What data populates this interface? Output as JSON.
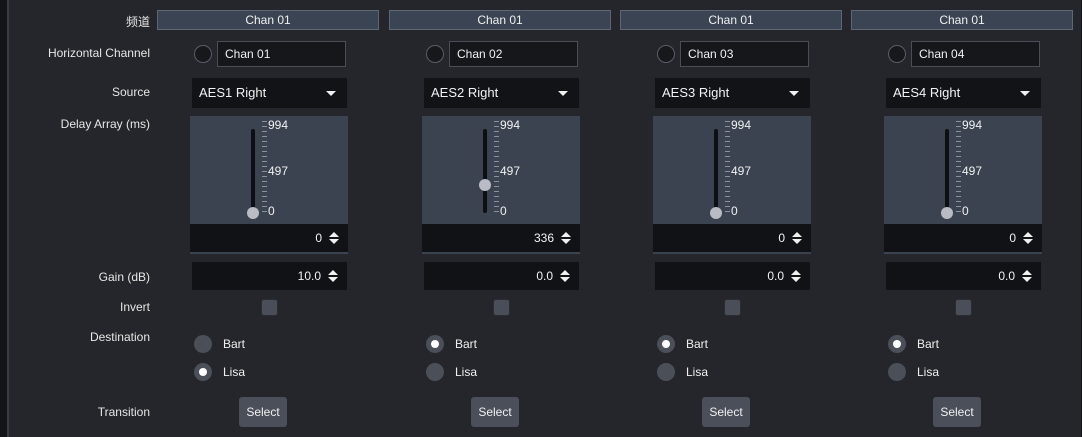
{
  "labels": {
    "header": "频道",
    "horizontal_channel": "Horizontal Channel",
    "source": "Source",
    "delay_array": "Delay Array (ms)",
    "gain": "Gain (dB)",
    "invert": "Invert",
    "destination": "Destination",
    "transition": "Transition"
  },
  "slider_scale": {
    "max": "994",
    "mid": "497",
    "min": "0"
  },
  "channels": [
    {
      "header": "Chan 01",
      "name": "Chan 01",
      "source": "AES1 Right",
      "delay": "0",
      "delay_level": 0,
      "gain": "10.0",
      "invert": false,
      "destination": "Lisa",
      "dest_options": [
        "Bart",
        "Lisa"
      ],
      "transition_button": "Select"
    },
    {
      "header": "Chan 01",
      "name": "Chan 02",
      "source": "AES2 Right",
      "delay": "336",
      "delay_level": 0.338,
      "gain": "0.0",
      "invert": false,
      "destination": "Bart",
      "dest_options": [
        "Bart",
        "Lisa"
      ],
      "transition_button": "Select"
    },
    {
      "header": "Chan 01",
      "name": "Chan 03",
      "source": "AES3 Right",
      "delay": "0",
      "delay_level": 0,
      "gain": "0.0",
      "invert": false,
      "destination": "Bart",
      "dest_options": [
        "Bart",
        "Lisa"
      ],
      "transition_button": "Select"
    },
    {
      "header": "Chan 01",
      "name": "Chan 04",
      "source": "AES4 Right",
      "delay": "0",
      "delay_level": 0,
      "gain": "0.0",
      "invert": false,
      "destination": "Bart",
      "dest_options": [
        "Bart",
        "Lisa"
      ],
      "transition_button": "Select"
    }
  ],
  "colors": {
    "panel": "#25262b",
    "header_bg": "#3a4452",
    "slider_bg": "#3b4351",
    "field_bg": "#121316"
  }
}
